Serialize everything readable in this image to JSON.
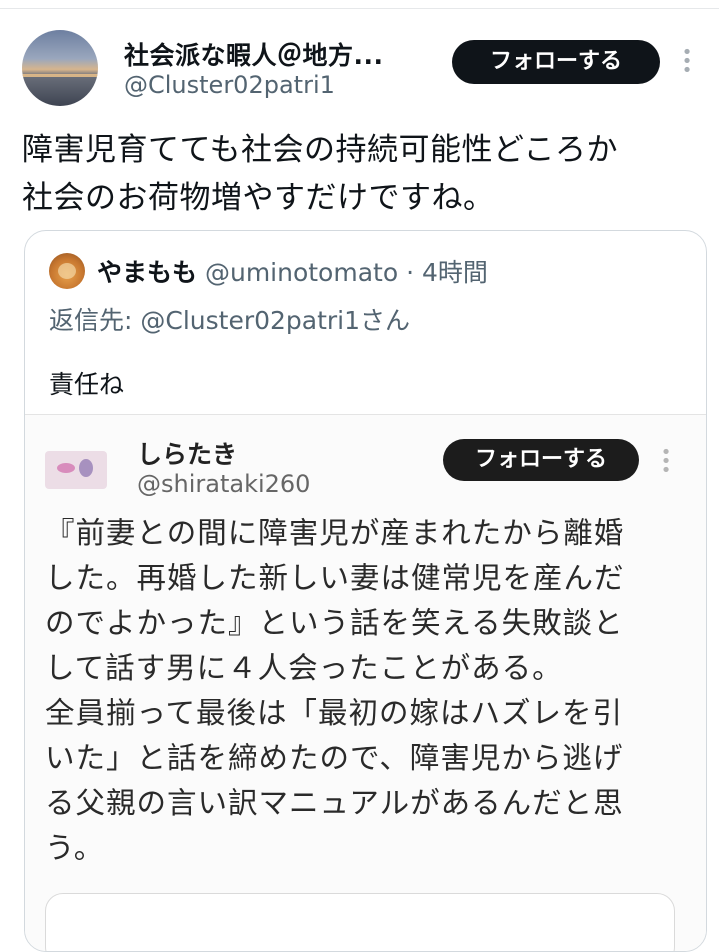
{
  "tweet": {
    "author_name": "社会派な暇人＠地方...",
    "author_handle": "@Cluster02patri1",
    "follow_label": "フォローする",
    "text_lines": [
      "障害児育てても社会の持続可能性どころか",
      "社会のお荷物増やすだけですね。"
    ]
  },
  "quote": {
    "author_name": "やまもも",
    "author_handle": "@uminotomato",
    "separator": " · ",
    "time": "4時間",
    "reply_to": "返信先: @Cluster02patri1さん",
    "text": "責任ね",
    "embedded": {
      "author_name": "しらたき",
      "author_handle": "@shirataki260",
      "follow_label": "フォローする",
      "lines": [
        "『前妻との間に障害児が産まれたから離婚",
        "した。再婚した新しい妻は健常児を産んだ",
        "のでよかった』という話を笑える失敗談と",
        "して話す男に４人会ったことがある。",
        "全員揃って最後は「最初の嫁はハズレを引",
        "いた」と話を締めたので、障害児から逃げ",
        "る父親の言い訳マニュアルがあるんだと思",
        "う。"
      ]
    }
  },
  "icons": {
    "more": "more-vertical-icon",
    "embedded_more": "more-vertical-icon"
  },
  "colors": {
    "follow_bg": "#0f1419",
    "secondary_text": "#536471",
    "border": "#d3d9de"
  }
}
